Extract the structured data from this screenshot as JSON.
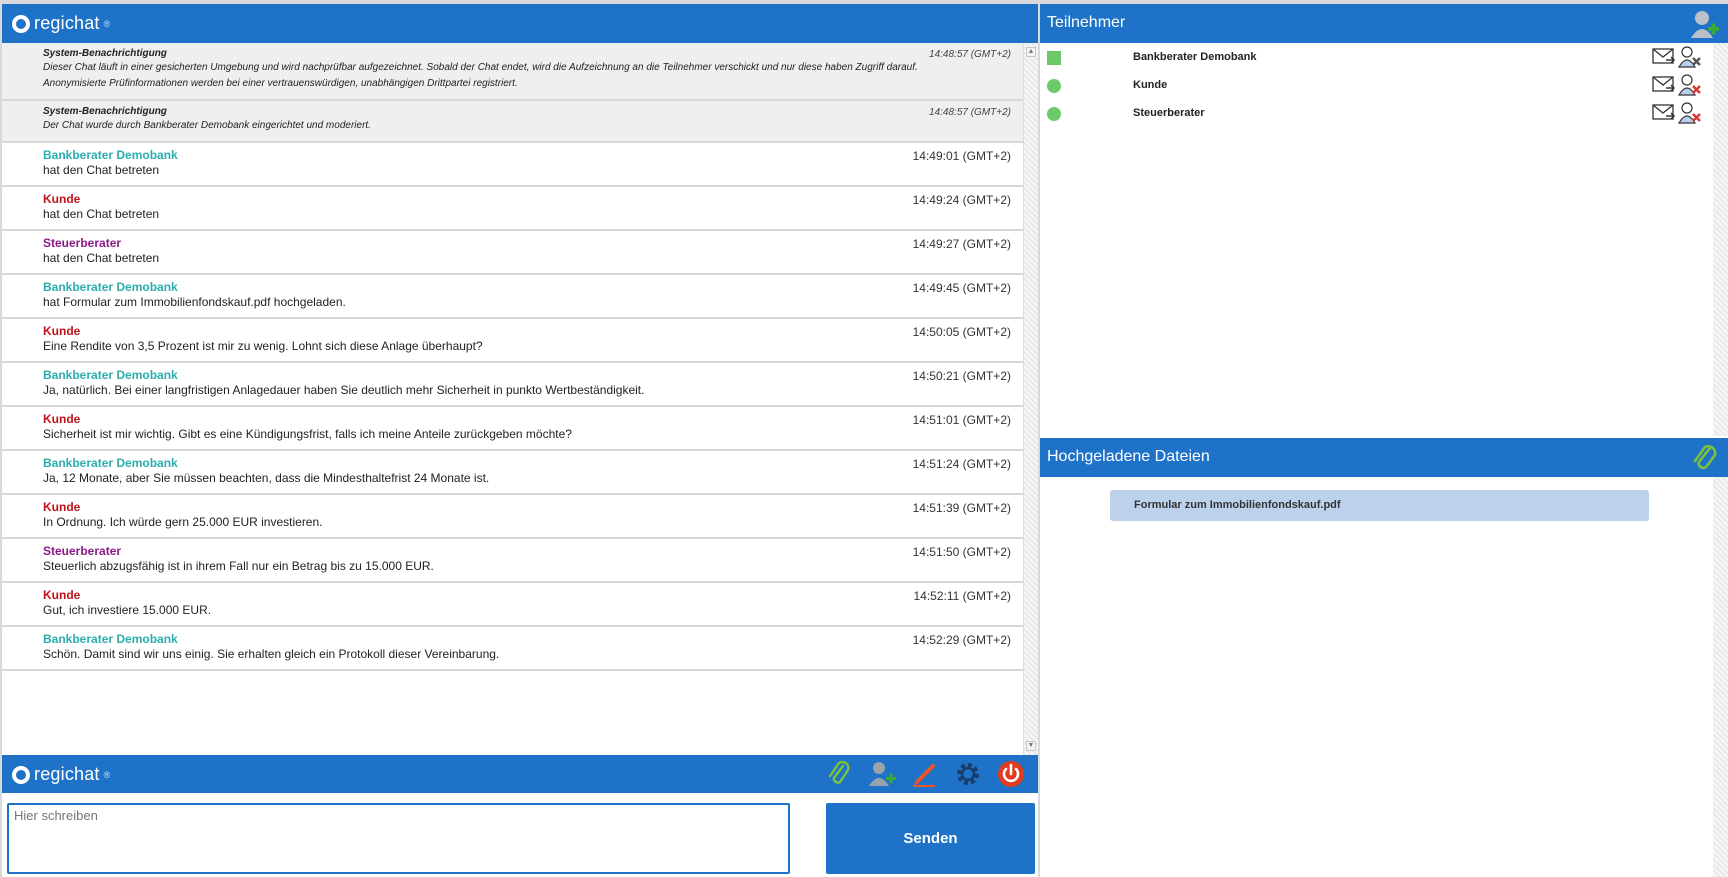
{
  "brand": {
    "name": "regichat",
    "mark": "®"
  },
  "chat": {
    "system_messages": [
      {
        "title": "System-Benachrichtigung",
        "time": "14:48:57 (GMT+2)",
        "lines": [
          "Dieser Chat läuft in einer gesicherten Umgebung und wird nachprüfbar aufgezeichnet. Sobald der Chat endet, wird die Aufzeichnung an die Teilnehmer verschickt und nur diese haben Zugriff darauf.",
          "Anonymisierte Prüfinformationen werden bei einer vertrauenswürdigen, unabhängigen Drittpartei registriert."
        ]
      },
      {
        "title": "System-Benachrichtigung",
        "time": "14:48:57 (GMT+2)",
        "lines": [
          "Der Chat wurde durch Bankberater Demobank eingerichtet und moderiert."
        ]
      }
    ],
    "messages": [
      {
        "sender": "Bankberater Demobank",
        "color": "#2aaeb0",
        "time": "14:49:01 (GMT+2)",
        "text": "hat den Chat betreten"
      },
      {
        "sender": "Kunde",
        "color": "#c0141c",
        "time": "14:49:24 (GMT+2)",
        "text": "hat den Chat betreten"
      },
      {
        "sender": "Steuerberater",
        "color": "#8b1a86",
        "time": "14:49:27 (GMT+2)",
        "text": "hat den Chat betreten"
      },
      {
        "sender": "Bankberater Demobank",
        "color": "#2aaeb0",
        "time": "14:49:45 (GMT+2)",
        "text": "hat Formular zum Immobilienfondskauf.pdf hochgeladen."
      },
      {
        "sender": "Kunde",
        "color": "#c0141c",
        "time": "14:50:05 (GMT+2)",
        "text": "Eine Rendite von 3,5 Prozent ist mir zu wenig. Lohnt sich diese Anlage überhaupt?"
      },
      {
        "sender": "Bankberater Demobank",
        "color": "#2aaeb0",
        "time": "14:50:21 (GMT+2)",
        "text": "Ja, natürlich. Bei einer langfristigen Anlagedauer haben Sie deutlich mehr Sicherheit in punkto Wertbeständigkeit."
      },
      {
        "sender": "Kunde",
        "color": "#c0141c",
        "time": "14:51:01 (GMT+2)",
        "text": "Sicherheit ist mir wichtig. Gibt es eine Kündigungsfrist, falls ich meine Anteile zurückgeben möchte?"
      },
      {
        "sender": "Bankberater Demobank",
        "color": "#2aaeb0",
        "time": "14:51:24 (GMT+2)",
        "text": "Ja, 12 Monate, aber Sie müssen beachten, dass die Mindesthaltefrist 24 Monate ist."
      },
      {
        "sender": "Kunde",
        "color": "#c0141c",
        "time": "14:51:39 (GMT+2)",
        "text": "In Ordnung. Ich würde gern 25.000 EUR investieren."
      },
      {
        "sender": "Steuerberater",
        "color": "#8b1a86",
        "time": "14:51:50 (GMT+2)",
        "text": "Steuerlich abzugsfähig ist in ihrem Fall nur ein Betrag bis zu 15.000 EUR."
      },
      {
        "sender": "Kunde",
        "color": "#c0141c",
        "time": "14:52:11 (GMT+2)",
        "text": "Gut, ich investiere 15.000 EUR."
      },
      {
        "sender": "Bankberater Demobank",
        "color": "#2aaeb0",
        "time": "14:52:29 (GMT+2)",
        "text": "Schön. Damit sind wir uns einig. Sie erhalten gleich ein Protokoll dieser Vereinbarung."
      }
    ]
  },
  "toolbar": {
    "tools": [
      "paperclip-icon",
      "add-user-icon",
      "pen-icon",
      "gear-icon",
      "power-icon"
    ]
  },
  "compose": {
    "placeholder": "Hier schreiben",
    "send_label": "Senden"
  },
  "participants": {
    "title": "Teilnehmer",
    "items": [
      {
        "name": "Bankberater Demobank",
        "status": "online-square"
      },
      {
        "name": "Kunde",
        "status": "online"
      },
      {
        "name": "Steuerberater",
        "status": "online"
      }
    ]
  },
  "files": {
    "title": "Hochgeladene Dateien",
    "items": [
      "Formular zum Immobilienfondskauf.pdf"
    ]
  },
  "colors": {
    "accent": "#1e73c8",
    "online": "#6cc96a",
    "file_bg": "#bcd1ec"
  }
}
